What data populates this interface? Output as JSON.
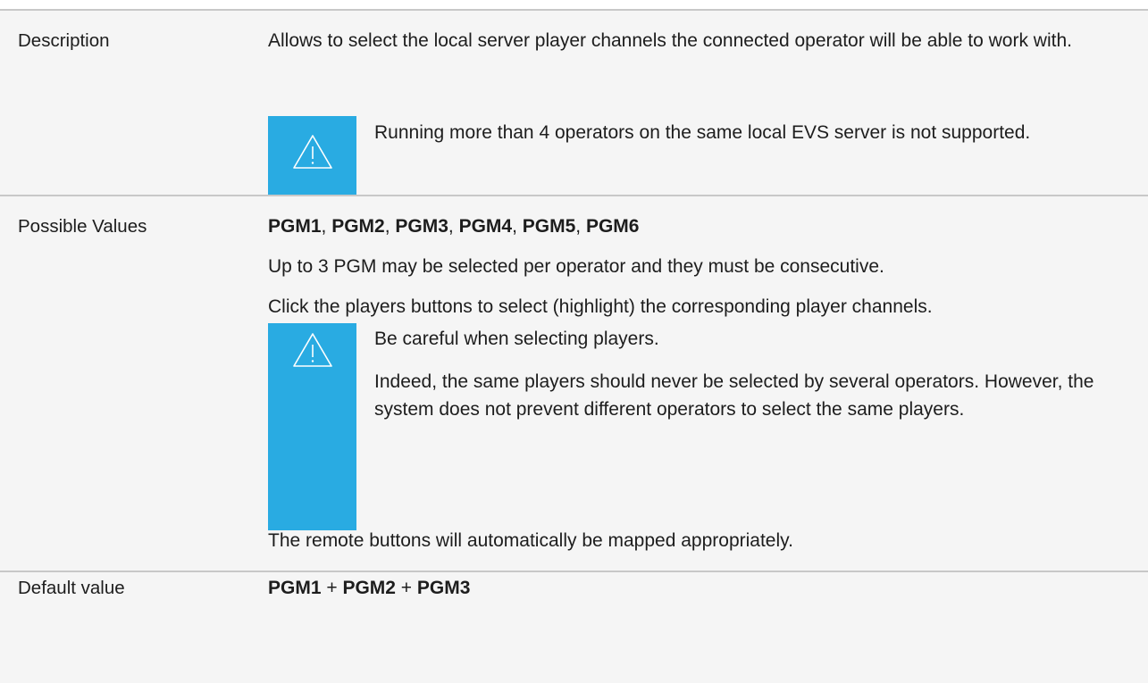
{
  "rows": {
    "description": {
      "label": "Description",
      "text": "Allows to select the local server player channels the connected operator will be able to work with.",
      "note": {
        "icon": "warning-icon",
        "text": "Running more than 4 operators on the same local EVS server is not supported."
      }
    },
    "possible_values": {
      "label": "Possible Values",
      "values": [
        "PGM1",
        "PGM2",
        "PGM3",
        "PGM4",
        "PGM5",
        "PGM6"
      ],
      "separator": ", ",
      "para1": "Up to 3 PGM may be selected per operator and they must be consecutive.",
      "para2": "Click the players buttons to select (highlight) the corresponding player channels.",
      "note": {
        "icon": "warning-icon",
        "heading": "Be careful when selecting players.",
        "text": "Indeed, the same players should never be selected by several operators. However, the system does not prevent different operators to select the same players."
      },
      "para3": "The remote buttons will automatically be mapped appropriately."
    },
    "default_value": {
      "label": "Default value",
      "values": [
        "PGM1",
        "PGM2",
        "PGM3"
      ],
      "separator": " + "
    }
  },
  "colors": {
    "note_accent": "#29abe2",
    "row_background": "#f5f5f5",
    "divider": "#c8c8c8"
  }
}
